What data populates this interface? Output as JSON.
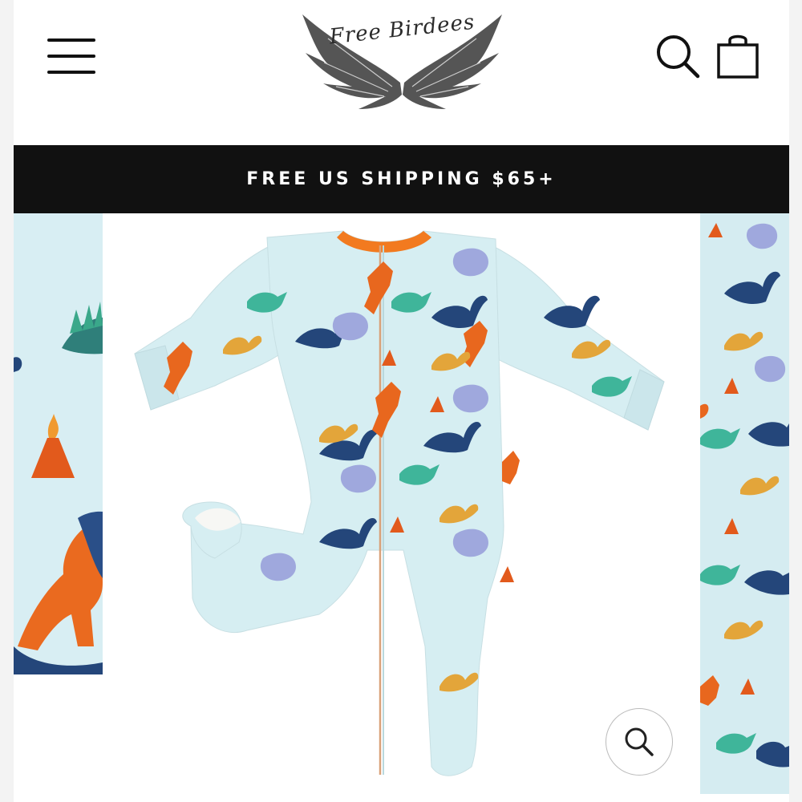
{
  "header": {
    "logo_text": "Free Birdees",
    "menu_icon": "hamburger-menu-icon",
    "search_icon": "search-icon",
    "cart_icon": "shopping-bag-icon"
  },
  "announcement": {
    "text": "FREE US SHIPPING $65+"
  },
  "gallery": {
    "zoom_icon": "zoom-icon",
    "product_image": "dinosaur-print-footed-zip-pajama"
  },
  "colors": {
    "announcement_bg": "#111111",
    "announcement_text": "#ffffff",
    "fabric": "#d6eef2",
    "trim": "#f07a1f",
    "dino_navy": "#24467a",
    "dino_orange": "#e8671e",
    "dino_teal": "#3fb59a",
    "dino_gold": "#e3a53a",
    "dino_lavender": "#9fa8dd"
  }
}
